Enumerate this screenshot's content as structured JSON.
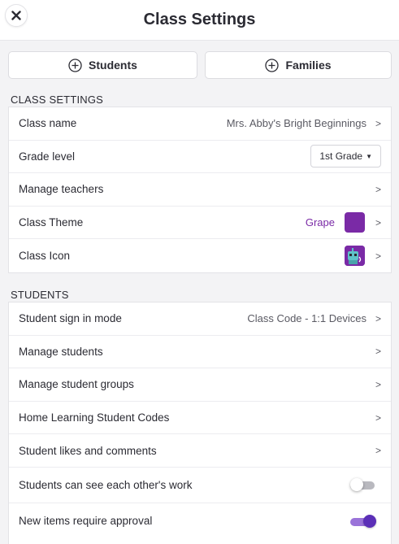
{
  "header": {
    "title": "Class Settings",
    "close_icon": "close-icon"
  },
  "top_buttons": {
    "students_label": "Students",
    "families_label": "Families",
    "icon": "plus-circle-icon"
  },
  "class_settings": {
    "section_title": "CLASS SETTINGS",
    "class_name_label": "Class name",
    "class_name_value": "Mrs. Abby's Bright Beginnings",
    "grade_level_label": "Grade level",
    "grade_level_value": "1st Grade",
    "manage_teachers_label": "Manage teachers",
    "class_theme_label": "Class Theme",
    "class_theme_value": "Grape",
    "class_theme_color": "#7a2aa6",
    "class_icon_label": "Class Icon",
    "class_icon_name": "robot-icon"
  },
  "students": {
    "section_title": "STUDENTS",
    "sign_in_mode_label": "Student sign in mode",
    "sign_in_mode_value": "Class Code - 1:1 Devices",
    "manage_students_label": "Manage students",
    "manage_groups_label": "Manage student groups",
    "home_codes_label": "Home Learning Student Codes",
    "likes_comments_label": "Student likes and comments",
    "see_work_label": "Students can see each other's work",
    "see_work_enabled": false,
    "approval_label": "New items require approval",
    "approval_enabled": true
  },
  "chevron_glyph": ">",
  "colors": {
    "accent_purple": "#7a2aa6",
    "toggle_on": "#5b2fb7"
  }
}
